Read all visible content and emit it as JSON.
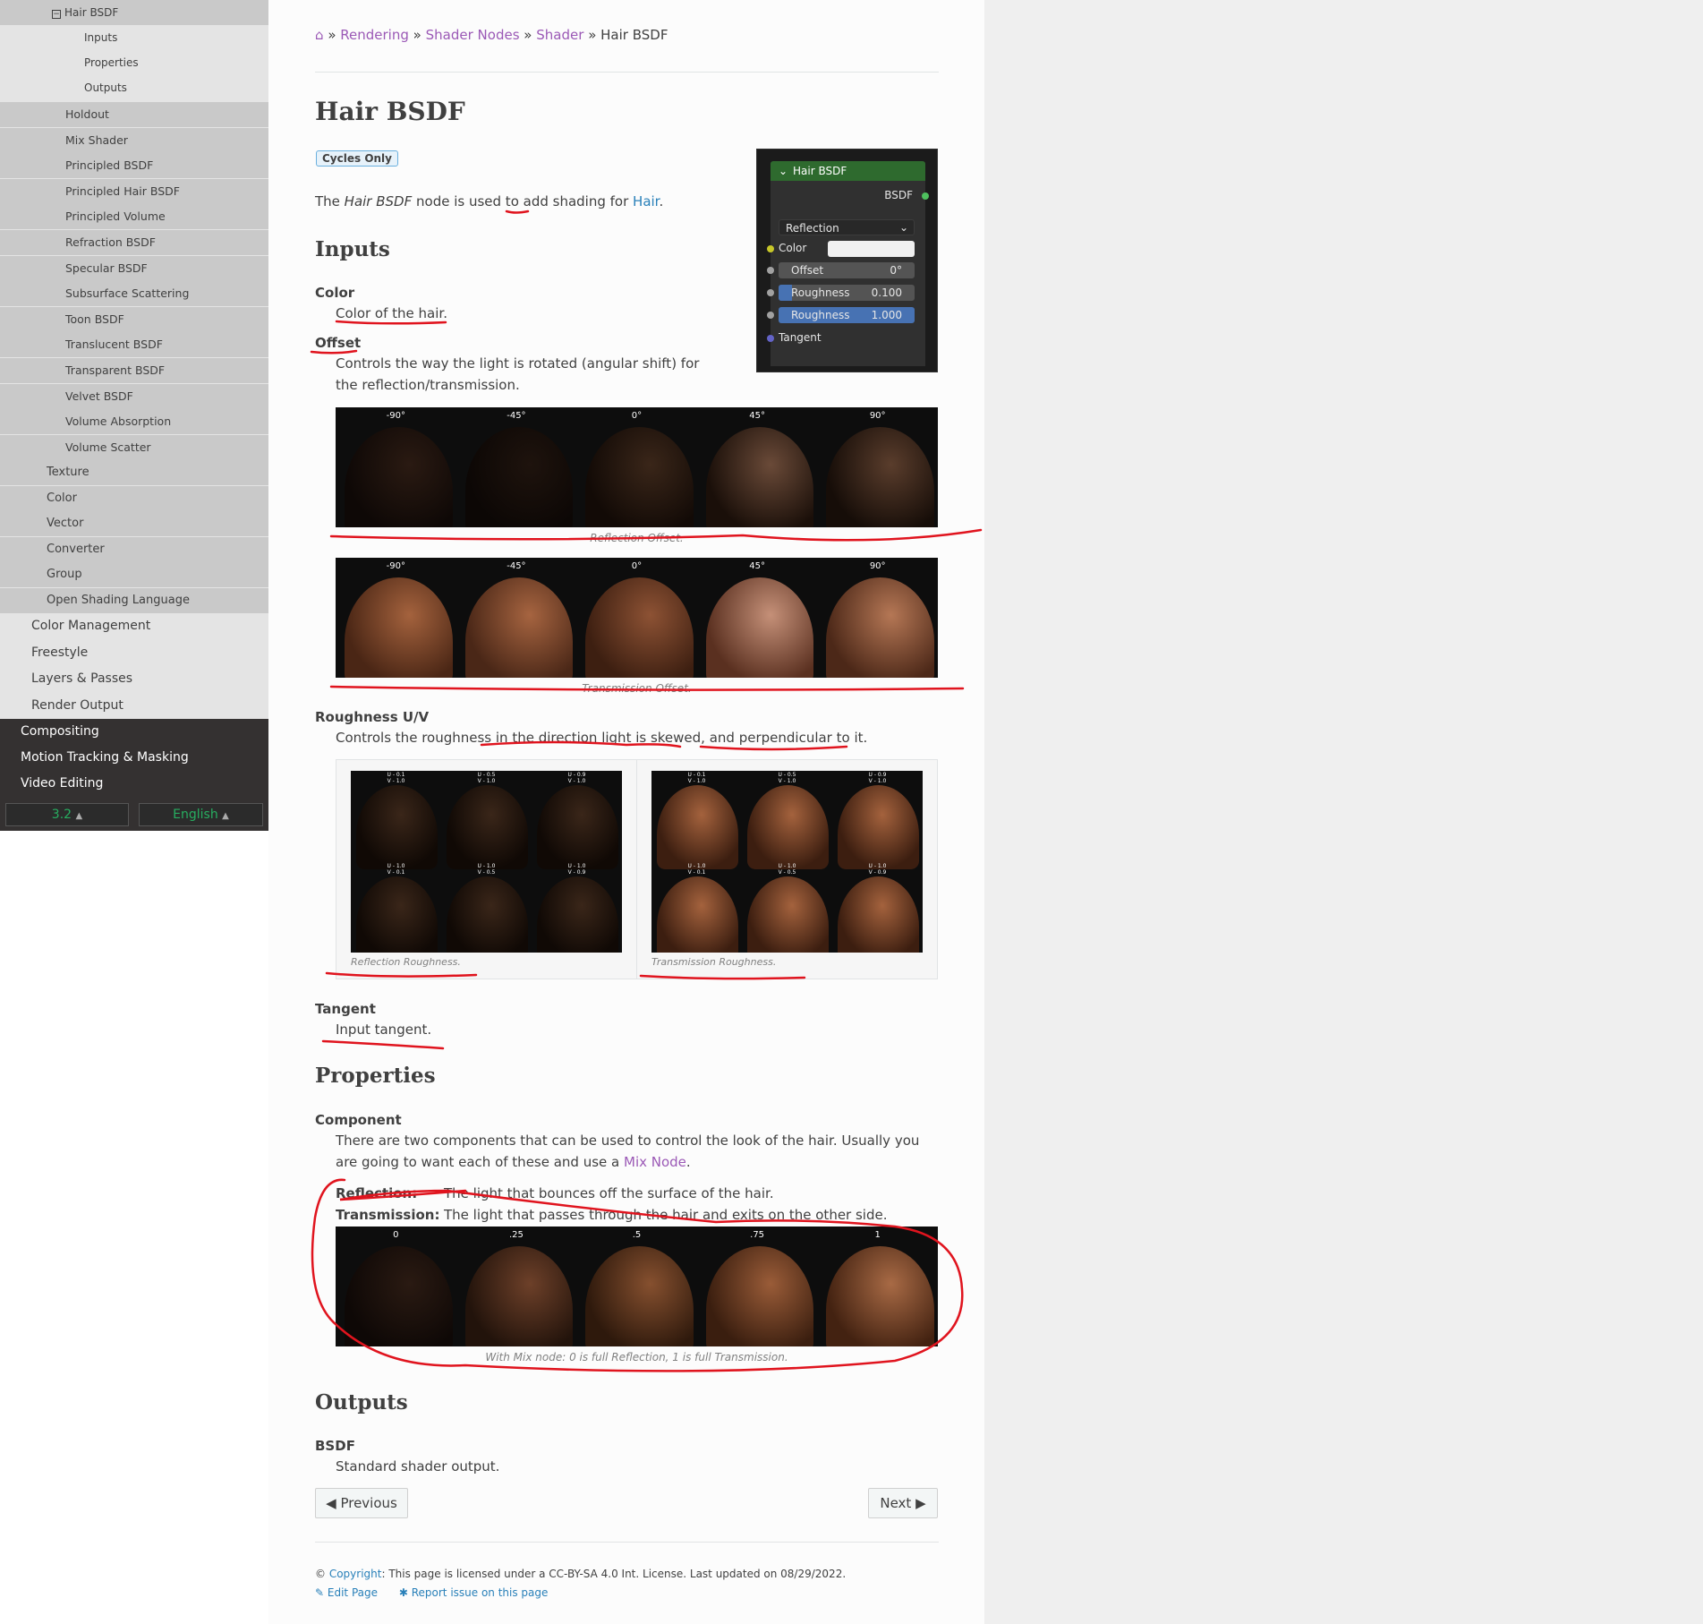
{
  "sidebar": {
    "current": "Hair BSDF",
    "sub": [
      "Inputs",
      "Properties",
      "Outputs"
    ],
    "shader_items": [
      "Holdout",
      "Mix Shader",
      "Principled BSDF",
      "Principled Hair BSDF",
      "Principled Volume",
      "Refraction BSDF",
      "Specular BSDF",
      "Subsurface Scattering",
      "Toon BSDF",
      "Translucent BSDF",
      "Transparent BSDF",
      "Velvet BSDF",
      "Volume Absorption",
      "Volume Scatter"
    ],
    "node_cats": [
      "Texture",
      "Color",
      "Vector",
      "Converter",
      "Group",
      "Open Shading Language"
    ],
    "rendering_items": [
      "Color Management",
      "Freestyle",
      "Layers & Passes",
      "Render Output"
    ],
    "top_items": [
      "Compositing",
      "Motion Tracking & Masking",
      "Video Editing"
    ],
    "version": "3.2",
    "language": "English"
  },
  "breadcrumb": {
    "home_icon": "home-icon",
    "sep": "»",
    "items": [
      "Rendering",
      "Shader Nodes",
      "Shader"
    ],
    "current": "Hair BSDF"
  },
  "page": {
    "title": "Hair BSDF",
    "badge": "Cycles Only",
    "intro_a": "The ",
    "intro_em": "Hair BSDF",
    "intro_b": " node is used to add shading for ",
    "intro_link": "Hair",
    "intro_c": ".",
    "inputs_heading": "Inputs",
    "color_term": "Color",
    "color_desc": "Color of the hair.",
    "offset_term": "Offset",
    "offset_desc": "Controls the way the light is rotated (angular shift) for the reflection/transmission.",
    "offset_labels": [
      "-90°",
      "-45°",
      "0°",
      "45°",
      "90°"
    ],
    "reflection_offset_caption": "Reflection Offset.",
    "transmission_offset_caption": "Transmission Offset.",
    "roughness_term": "Roughness U/V",
    "roughness_desc": "Controls the roughness in the direction light is skewed, and perpendicular to it.",
    "rough_labels_top": [
      "U - 0.1\nV - 1.0",
      "U - 0.5\nV - 1.0",
      "U - 0.9\nV - 1.0"
    ],
    "rough_labels_bottom": [
      "U - 1.0\nV - 0.1",
      "U - 1.0\nV - 0.5",
      "U - 1.0\nV - 0.9"
    ],
    "reflection_roughness_caption": "Reflection Roughness.",
    "transmission_roughness_caption": "Transmission Roughness.",
    "tangent_term": "Tangent",
    "tangent_desc": "Input tangent.",
    "properties_heading": "Properties",
    "component_term": "Component",
    "component_desc_a": "There are two components that can be used to control the look of the hair. Usually you are going to want each of these and use a ",
    "component_link": "Mix Node",
    "component_desc_b": ".",
    "reflection_label": "Reflection:",
    "reflection_text": "The light that bounces off the surface of the hair.",
    "transmission_label": "Transmission:",
    "transmission_text": "The light that passes through the hair and exits on the other side.",
    "mix_labels": [
      "0",
      ".25",
      ".5",
      ".75",
      "1"
    ],
    "mix_caption": "With Mix node: 0 is full Reflection, 1 is full Transmission.",
    "outputs_heading": "Outputs",
    "bsdf_term": "BSDF",
    "bsdf_desc": "Standard shader output."
  },
  "node": {
    "title": "Hair BSDF",
    "output": "BSDF",
    "dropdown": "Reflection",
    "color_label": "Color",
    "offset_label": "Offset",
    "offset_value": "0°",
    "roughness_label": "Roughness",
    "roughness_u": "0.100",
    "roughness_v": "1.000",
    "tangent_label": "Tangent"
  },
  "nav": {
    "previous": "Previous",
    "next": "Next"
  },
  "footer": {
    "copyright_sym": "©",
    "copyright_link": "Copyright",
    "license": ": This page is licensed under a CC-BY-SA 4.0 Int. License. Last updated on 08/29/2022.",
    "edit": "Edit Page",
    "report": "Report issue on this page"
  },
  "colors": {
    "link": "#9b59b6",
    "blue": "#2980b9",
    "node_header": "#2e6a2e",
    "annotation": "#e0141e"
  }
}
